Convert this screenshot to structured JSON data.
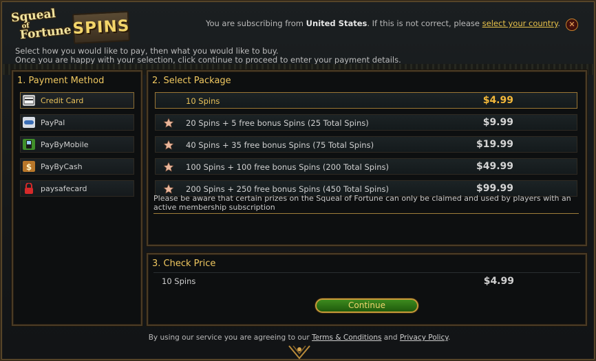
{
  "header": {
    "logo": {
      "squeal_text": [
        "Squeal",
        "of",
        "Fortune"
      ],
      "spins_text": "SPINS"
    },
    "subscribe": {
      "prefix": "You are subscribing from",
      "country": "United States",
      "middle": ". If this is not correct, please",
      "link": "select your country",
      "suffix": "."
    },
    "close_icon": "close-icon"
  },
  "instructions": [
    "Select how you would like to pay, then what you would like to buy.",
    "Once you are happy with your selection, click continue to proceed to enter your payment details."
  ],
  "payment_method": {
    "title": "1. Payment Method",
    "items": [
      {
        "label": "Credit Card",
        "icon": "credit-card-icon",
        "selected": true
      },
      {
        "label": "PayPal",
        "icon": "paypal-icon",
        "selected": false
      },
      {
        "label": "PayByMobile",
        "icon": "mobile-phone-icon",
        "selected": false
      },
      {
        "label": "PayByCash",
        "icon": "cash-icon",
        "selected": false
      },
      {
        "label": "paysafecard",
        "icon": "padlock-icon",
        "selected": false
      }
    ]
  },
  "package": {
    "title": "2. Select Package",
    "items": [
      {
        "label": "10 Spins",
        "price": "$4.99",
        "star": false,
        "selected": true
      },
      {
        "label": "20 Spins + 5 free bonus Spins (25 Total Spins)",
        "price": "$9.99",
        "star": true,
        "selected": false
      },
      {
        "label": "40 Spins + 35 free bonus Spins (75 Total Spins)",
        "price": "$19.99",
        "star": true,
        "selected": false
      },
      {
        "label": "100 Spins + 100 free bonus Spins (200 Total Spins)",
        "price": "$49.99",
        "star": true,
        "selected": false
      },
      {
        "label": "200 Spins + 250 free bonus Spins (450 Total Spins)",
        "price": "$99.99",
        "star": true,
        "selected": false
      }
    ],
    "notice": "Please be aware that certain prizes on the Squeal of Fortune can only be claimed and used by players with an active membership subscription"
  },
  "check_price": {
    "title": "3. Check Price",
    "item": "10 Spins",
    "price": "$4.99",
    "continue_label": "Continue"
  },
  "footer": {
    "prefix": "By using our service you are agreeing to our",
    "terms_link": "Terms & Conditions",
    "and": "and",
    "privacy_link": "Privacy Policy",
    "suffix": "."
  },
  "colors": {
    "accent_gold": "#f0c860",
    "price_selected": "#f3b83a",
    "continue_green": "#2f7a16"
  }
}
